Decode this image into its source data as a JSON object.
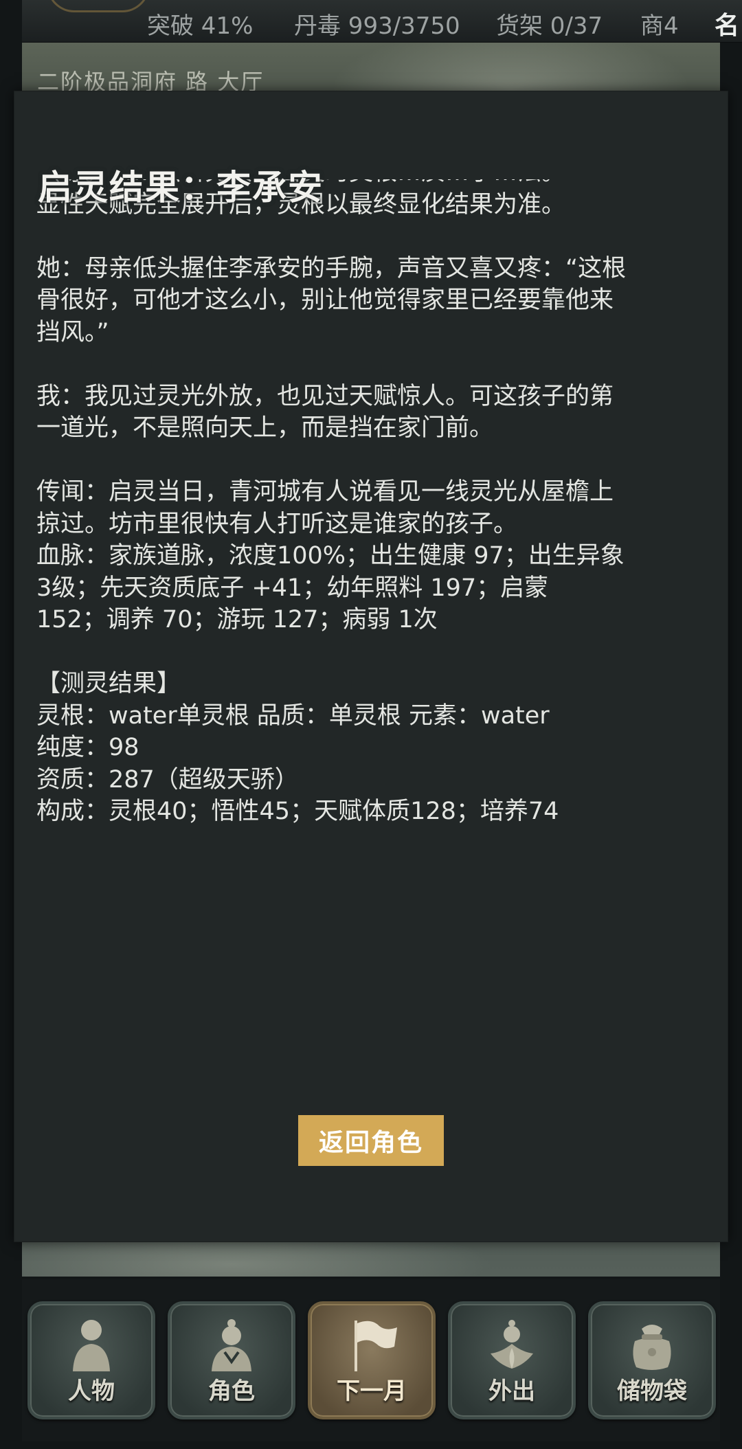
{
  "status_bar": {
    "breakthrough": "突破 41%",
    "pill_poison": "丹毒 993/3750",
    "shelf": "货架 0/37",
    "merchant": "商4",
    "name_truncated": "名"
  },
  "location": "二阶极品洞府 路 大厅",
  "modal": {
    "title": "启灵结果：李承安",
    "body_lines": [
      "（等。……照料充实，启灵时灵根…质…了…法。",
      "显性天赋完全展开后，灵根以最终显化结果为准。",
      "",
      "她：母亲低头握住李承安的手腕，声音又喜又疼：“这根",
      "骨很好，可他才这么小，别让他觉得家里已经要靠他来",
      "挡风。”",
      "",
      "我：我见过灵光外放，也见过天赋惊人。可这孩子的第",
      "一道光，不是照向天上，而是挡在家门前。",
      "",
      "传闻：启灵当日，青河城有人说看见一线灵光从屋檐上",
      "掠过。坊市里很快有人打听这是谁家的孩子。",
      "血脉：家族道脉，浓度100%；出生健康 97；出生异象",
      "3级；先天资质底子 +41；幼年照料 197；启蒙",
      "152；调养 70；游玩 127；病弱 1次",
      "",
      "【测灵结果】",
      "灵根：water单灵根    品质：单灵根    元素：water",
      "纯度：98",
      "资质：287（超级天骄）",
      "构成：灵根40；悟性45；天赋体质128；培养74"
    ],
    "return_button": "返回角色"
  },
  "bottom_nav": [
    {
      "label": "人物",
      "icon": "person-icon",
      "active": false
    },
    {
      "label": "角色",
      "icon": "character-icon",
      "active": false
    },
    {
      "label": "下一月",
      "icon": "flag-icon",
      "active": true
    },
    {
      "label": "外出",
      "icon": "lotus-figure-icon",
      "active": false
    },
    {
      "label": "储物袋",
      "icon": "storage-bag-icon",
      "active": false
    }
  ],
  "colors": {
    "modal_bg": "#222727",
    "accent_button": "#d3a956",
    "text": "#e4e6e2"
  }
}
